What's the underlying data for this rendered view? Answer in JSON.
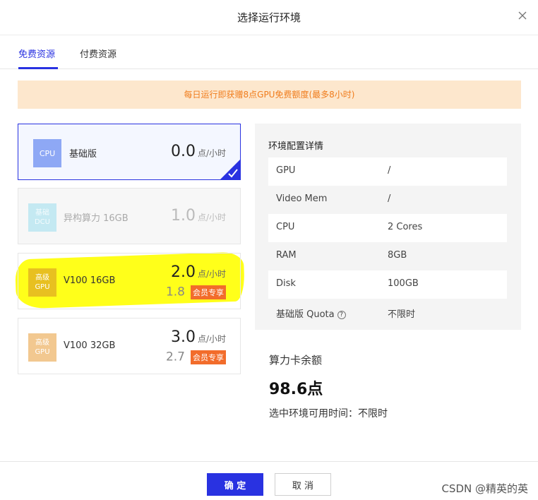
{
  "dialog": {
    "title": "选择运行环境"
  },
  "tabs": [
    {
      "label": "免费资源",
      "active": true
    },
    {
      "label": "付费资源",
      "active": false
    }
  ],
  "notice": "每日运行即获赠8点GPU免费额度(最多8小时)",
  "cards": [
    {
      "chip": [
        "CPU"
      ],
      "name": "基础版",
      "price": "0.0",
      "unit": "点/小时",
      "state": "selected"
    },
    {
      "chip": [
        "基础",
        "DCU"
      ],
      "name": "异构算力 16GB",
      "price": "1.0",
      "unit": "点/小时",
      "state": "disabled"
    },
    {
      "chip": [
        "高级",
        "GPU"
      ],
      "name": "V100 16GB",
      "price": "2.0",
      "unit": "点/小时",
      "member_price": "1.8",
      "member_badge": "会员专享",
      "state": "normal"
    },
    {
      "chip": [
        "高级",
        "GPU"
      ],
      "name": "V100 32GB",
      "price": "3.0",
      "unit": "点/小时",
      "member_price": "2.7",
      "member_badge": "会员专享",
      "state": "normal"
    }
  ],
  "config": {
    "title": "环境配置详情",
    "rows": [
      {
        "key": "GPU",
        "value": "/"
      },
      {
        "key": "Video Mem",
        "value": "/"
      },
      {
        "key": "CPU",
        "value": "2 Cores"
      },
      {
        "key": "RAM",
        "value": "8GB"
      },
      {
        "key": "Disk",
        "value": "100GB"
      },
      {
        "key": "基础版 Quota",
        "value": "不限时",
        "help_icon": "?"
      }
    ]
  },
  "balance": {
    "label": "算力卡余额",
    "value": "98.6点",
    "available": "选中环境可用时间：不限时"
  },
  "footer": {
    "ok_label": "确 定",
    "cancel_label": "取 消",
    "watermark": "CSDN @精英的英"
  },
  "colors": {
    "accent": "#2932e1",
    "notice_bg": "#fde7cd",
    "notice_text": "#f07c1c",
    "member_badge": "#f26c2b",
    "highlight": "#ffff1a"
  },
  "icons": {
    "close": "close-icon",
    "check": "check-icon",
    "help": "question-circle-icon"
  }
}
